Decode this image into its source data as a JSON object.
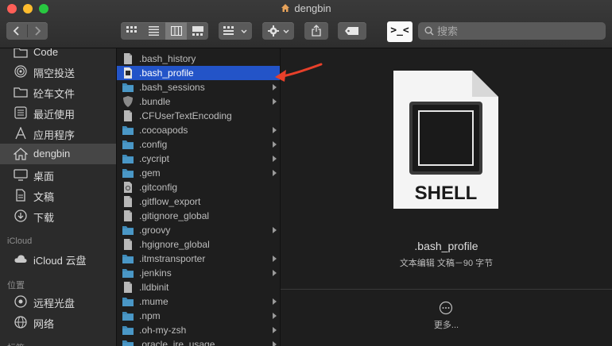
{
  "window": {
    "title": "dengbin"
  },
  "toolbar": {
    "search_placeholder": "搜索",
    "terminal_label": ">_<"
  },
  "sidebar": {
    "items_top": [
      {
        "label": "Code",
        "icon": "folder-icon"
      },
      {
        "label": "隔空投送",
        "icon": "airdrop-icon"
      },
      {
        "label": "砼车文件",
        "icon": "folder-icon"
      },
      {
        "label": "最近使用",
        "icon": "clock-icon"
      },
      {
        "label": "应用程序",
        "icon": "applications-icon"
      },
      {
        "label": "dengbin",
        "icon": "home-icon",
        "selected": true
      },
      {
        "label": "桌面",
        "icon": "desktop-icon"
      },
      {
        "label": "文稿",
        "icon": "documents-icon"
      },
      {
        "label": "下载",
        "icon": "download-icon"
      }
    ],
    "icloud_heading": "iCloud",
    "icloud_items": [
      {
        "label": "iCloud 云盘",
        "icon": "cloud-icon"
      }
    ],
    "location_heading": "位置",
    "location_items": [
      {
        "label": "远程光盘",
        "icon": "disc-icon"
      },
      {
        "label": "网络",
        "icon": "network-icon"
      }
    ],
    "tags_heading": "标签"
  },
  "files": [
    {
      "name": ".bash_history",
      "type": "file",
      "folder": false
    },
    {
      "name": ".bash_profile",
      "type": "script",
      "folder": false,
      "selected": true
    },
    {
      "name": ".bash_sessions",
      "type": "folder",
      "folder": true
    },
    {
      "name": ".bundle",
      "type": "shield",
      "folder": true
    },
    {
      "name": ".CFUserTextEncoding",
      "type": "file",
      "folder": false
    },
    {
      "name": ".cocoapods",
      "type": "folder",
      "folder": true
    },
    {
      "name": ".config",
      "type": "folder",
      "folder": true
    },
    {
      "name": ".cycript",
      "type": "folder",
      "folder": true
    },
    {
      "name": ".gem",
      "type": "folder",
      "folder": true
    },
    {
      "name": ".gitconfig",
      "type": "config",
      "folder": false
    },
    {
      "name": ".gitflow_export",
      "type": "file",
      "folder": false
    },
    {
      "name": ".gitignore_global",
      "type": "file",
      "folder": false
    },
    {
      "name": ".groovy",
      "type": "folder",
      "folder": true
    },
    {
      "name": ".hgignore_global",
      "type": "file",
      "folder": false
    },
    {
      "name": ".itmstransporter",
      "type": "folder",
      "folder": true
    },
    {
      "name": ".jenkins",
      "type": "folder",
      "folder": true
    },
    {
      "name": ".lldbinit",
      "type": "file",
      "folder": false
    },
    {
      "name": ".mume",
      "type": "folder",
      "folder": true
    },
    {
      "name": ".npm",
      "type": "folder",
      "folder": true
    },
    {
      "name": ".oh-my-zsh",
      "type": "folder",
      "folder": true
    },
    {
      "name": ".oracle_jre_usage",
      "type": "folder",
      "folder": true
    }
  ],
  "preview": {
    "icon_label": "SHELL",
    "filename": ".bash_profile",
    "meta": "文本编辑 文稿－90 字节",
    "more_label": "更多..."
  },
  "colors": {
    "selection": "#2354c8",
    "folder": "#3f8ab8",
    "annotation_arrow": "#e8402a"
  }
}
